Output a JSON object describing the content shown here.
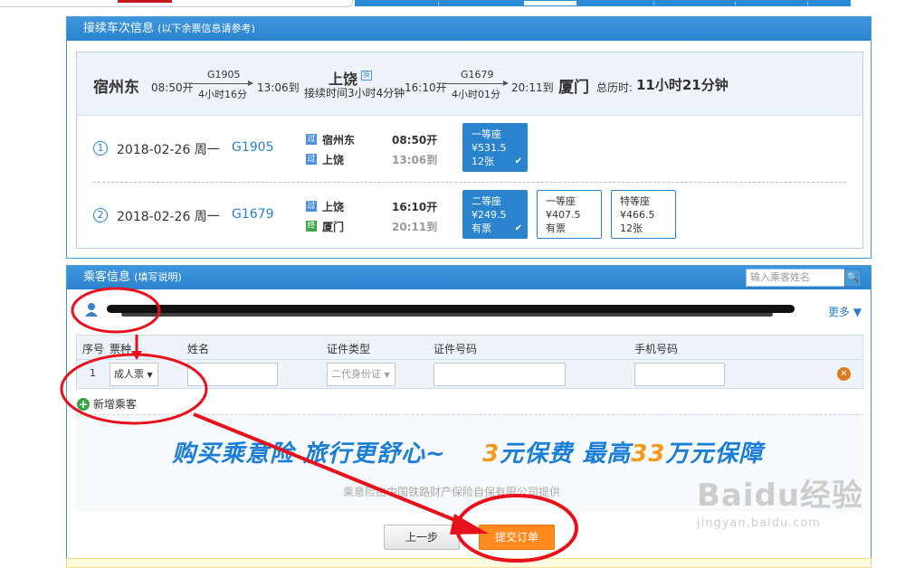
{
  "transfer": {
    "panel_title": "接续车次信息",
    "panel_note": "(以下余票信息请参考)",
    "summary": {
      "from_station": "宿州东",
      "dep1": "08:50开",
      "train1": "G1905",
      "dur1": "4小时16分",
      "arr1": "13:06到",
      "mid_station": "上饶",
      "transfer_icon": "transfer-icon",
      "transfer_wait": "接续时间3小时4分钟",
      "dep2": "16:10开",
      "train2": "G1679",
      "dur2": "4小时01分",
      "arr2": "20:11到",
      "to_station": "厦门",
      "total_label": "总历时:",
      "total_value": "11小时21分钟"
    },
    "legs": [
      {
        "index": "1",
        "date": "2018-02-26 周一",
        "train": "G1905",
        "stops": [
          {
            "tag": "过",
            "station": "宿州东",
            "time": "08:50开"
          },
          {
            "tag": "过",
            "station": "上饶",
            "time": "13:06到"
          }
        ],
        "seats": [
          {
            "class": "一等座",
            "price": "¥531.5",
            "avail": "12张",
            "selected": true
          }
        ]
      },
      {
        "index": "2",
        "date": "2018-02-26 周一",
        "train": "G1679",
        "stops": [
          {
            "tag": "过",
            "station": "上饶",
            "time": "16:10开"
          },
          {
            "tag": "终",
            "station": "厦门",
            "time": "20:11到"
          }
        ],
        "seats": [
          {
            "class": "二等座",
            "price": "¥249.5",
            "avail": "有票",
            "selected": true
          },
          {
            "class": "一等座",
            "price": "¥407.5",
            "avail": "有票",
            "selected": false
          },
          {
            "class": "特等座",
            "price": "¥466.5",
            "avail": "12张",
            "selected": false
          }
        ]
      }
    ]
  },
  "passenger": {
    "panel_title": "乘客信息",
    "panel_note": "(填写说明)",
    "search_placeholder": "输入乘客姓名",
    "more_label": "更多",
    "columns": [
      "序号",
      "票种",
      "姓名",
      "证件类型",
      "证件号码",
      "手机号码"
    ],
    "row": {
      "index": "1",
      "ticket_type": "成人票",
      "id_type": "二代身份证"
    },
    "add_label": "新增乘客"
  },
  "insurance": {
    "headline_a": "购买乘意险  旅行更舒心~",
    "headline_b1": "3",
    "headline_b2": "元保费  最高",
    "headline_b3": "33",
    "headline_b4": "万元保障",
    "provider": "乘意险由中国铁路财产保险自保有限公司提供"
  },
  "actions": {
    "prev_label": "上一步",
    "submit_label": "提交订单"
  },
  "watermark": {
    "line1": "Baidu经验",
    "line2": "jingyan.baidu.com"
  },
  "colors": {
    "brand_blue": "#2a83cd",
    "accent_orange": "#ff8a1f",
    "annotation_red": "#e8101a"
  }
}
